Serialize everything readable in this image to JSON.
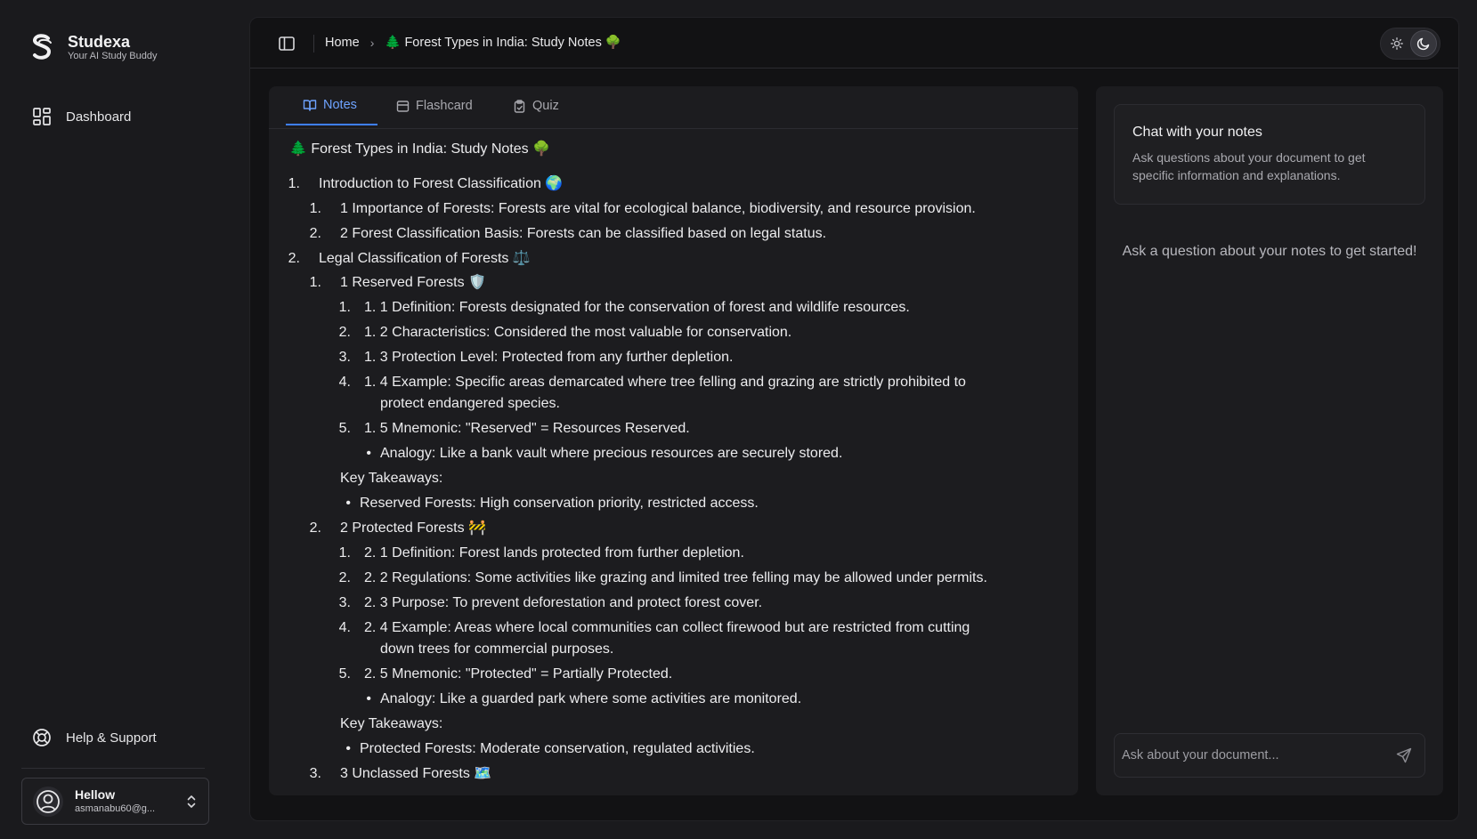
{
  "brand": {
    "name": "Studexa",
    "tagline": "Your AI Study Buddy"
  },
  "nav": {
    "dashboard": "Dashboard",
    "help": "Help & Support"
  },
  "user": {
    "name": "Hellow",
    "email": "asmanabu60@g..."
  },
  "breadcrumb": {
    "home": "Home",
    "current": "🌲 Forest Types in India: Study Notes 🌳"
  },
  "tabs": [
    {
      "label": "Notes",
      "icon": "book-open-icon",
      "active": true
    },
    {
      "label": "Flashcard",
      "icon": "card-icon",
      "active": false
    },
    {
      "label": "Quiz",
      "icon": "clipboard-check-icon",
      "active": false
    }
  ],
  "notes": {
    "title": "🌲 Forest Types in India: Study Notes 🌳",
    "lines": [
      {
        "marker": "1.",
        "text": "Introduction to Forest Classification 🌍"
      },
      {
        "marker": "1.",
        "text": "1 Importance of Forests: Forests are vital for ecological balance, biodiversity, and resource provision."
      },
      {
        "marker": "2.",
        "text": "2 Forest Classification Basis: Forests can be classified based on legal status."
      },
      {
        "marker": "2.",
        "text": "Legal Classification of Forests ⚖️"
      },
      {
        "marker": "1.",
        "text": "1 Reserved Forests 🛡️"
      },
      {
        "marker": "1.",
        "text": "1. 1 Definition: Forests designated for the conservation of forest and wildlife resources."
      },
      {
        "marker": "2.",
        "text": "1. 2 Characteristics: Considered the most valuable for conservation."
      },
      {
        "marker": "3.",
        "text": "1. 3 Protection Level: Protected from any further depletion."
      },
      {
        "marker": "4.",
        "text": "1. 4 Example: Specific areas demarcated where tree felling and grazing are strictly prohibited to"
      },
      {
        "marker": "",
        "text": "protect endangered species."
      },
      {
        "marker": "5.",
        "text": "1. 5 Mnemonic: \"Reserved\" = Resources Reserved."
      },
      {
        "marker": "•",
        "text": "Analogy: Like a bank vault where precious resources are securely stored."
      },
      {
        "marker": "",
        "text": "Key Takeaways:"
      },
      {
        "marker": "•",
        "text": "Reserved Forests: High conservation priority, restricted access."
      },
      {
        "marker": "2.",
        "text": "2 Protected Forests 🚧"
      },
      {
        "marker": "1.",
        "text": "2. 1 Definition: Forest lands protected from further depletion."
      },
      {
        "marker": "2.",
        "text": "2. 2 Regulations: Some activities like grazing and limited tree felling may be allowed under permits."
      },
      {
        "marker": "3.",
        "text": "2. 3 Purpose: To prevent deforestation and protect forest cover."
      },
      {
        "marker": "4.",
        "text": "2. 4 Example: Areas where local communities can collect firewood but are restricted from cutting"
      },
      {
        "marker": "",
        "text": "down trees for commercial purposes."
      },
      {
        "marker": "5.",
        "text": "2. 5 Mnemonic: \"Protected\" = Partially Protected."
      },
      {
        "marker": "•",
        "text": "Analogy: Like a guarded park where some activities are monitored."
      },
      {
        "marker": "",
        "text": "Key Takeaways:"
      },
      {
        "marker": "•",
        "text": "Protected Forests: Moderate conservation, regulated activities."
      },
      {
        "marker": "3.",
        "text": "3 Unclassed Forests 🗺️"
      }
    ]
  },
  "chat": {
    "title": "Chat with your notes",
    "description": "Ask questions about your document to get specific information and explanations.",
    "empty_state": "Ask a question about your notes to get started!",
    "input_placeholder": "Ask about your document..."
  },
  "colors": {
    "accent": "#3f7fff",
    "accent_text": "#6ea3ff",
    "background": "#1a1a1d",
    "panel": "#121214",
    "card": "#1c1c1f"
  }
}
